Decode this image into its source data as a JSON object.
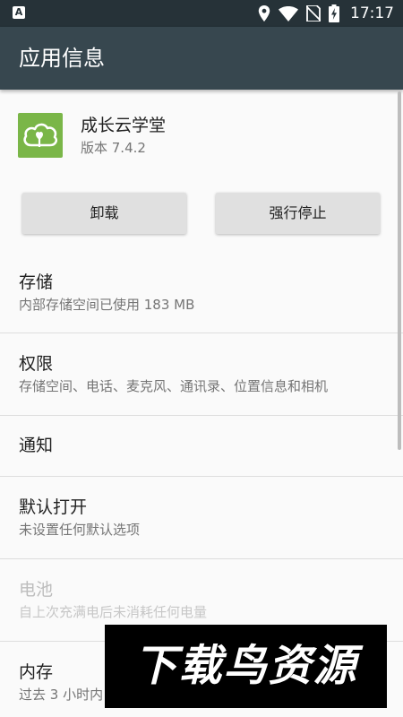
{
  "status_bar": {
    "notification_icon": "A",
    "time": "17:17",
    "icons": [
      "location-icon",
      "wifi-icon",
      "no-sim-icon",
      "battery-charging-icon"
    ]
  },
  "app_bar": {
    "title": "应用信息"
  },
  "app": {
    "name": "成长云学堂",
    "version": "版本 7.4.2",
    "icon": "cloud-app-icon"
  },
  "buttons": {
    "uninstall": "卸载",
    "force_stop": "强行停止"
  },
  "rows": {
    "storage": {
      "title": "存储",
      "summary": "内部存储空间已使用 183 MB"
    },
    "permissions": {
      "title": "权限",
      "summary": "存储空间、电话、麦克风、通讯录、位置信息和相机"
    },
    "notifications": {
      "title": "通知"
    },
    "open_by_default": {
      "title": "默认打开",
      "summary": "未设置任何默认选项"
    },
    "battery": {
      "title": "电池",
      "summary": "自上次充满电后未消耗任何电量"
    },
    "memory": {
      "title": "内存",
      "summary": "过去 3 小时内"
    }
  },
  "watermark": {
    "text": "下载鸟资源"
  },
  "colors": {
    "status_bar": "#263238",
    "app_bar": "#37474f",
    "app_icon": "#7ab648",
    "button": "#e0e0e0"
  }
}
